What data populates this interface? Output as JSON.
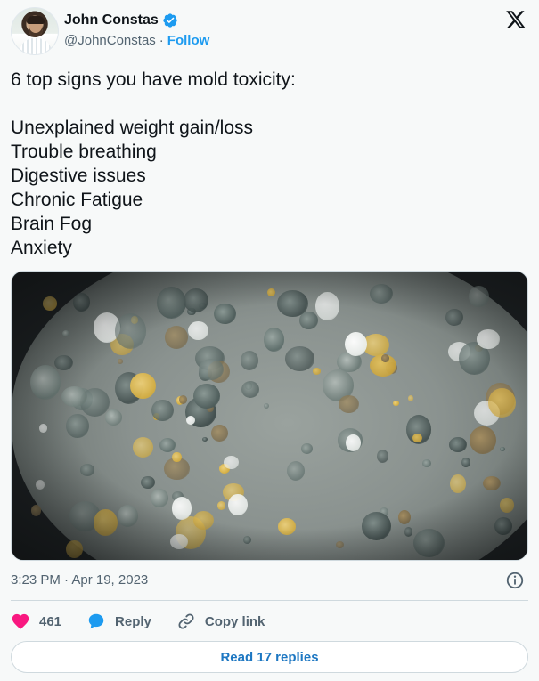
{
  "author": {
    "name": "John Constas",
    "handle": "@JohnConstas",
    "separator": "·",
    "follow_label": "Follow"
  },
  "tweet": {
    "intro": "6 top signs you have mold toxicity:",
    "signs": [
      "Unexplained weight gain/loss",
      "Trouble breathing",
      "Digestive issues",
      "Chronic Fatigue",
      "Brain Fog",
      "Anxiety"
    ],
    "timestamp": "3:23 PM · Apr 19, 2023"
  },
  "actions": {
    "like_count": "461",
    "reply_label": "Reply",
    "copy_link_label": "Copy link"
  },
  "read_replies_label": "Read 17 replies",
  "colors": {
    "accent": "#1d9bf0",
    "like": "#f91880",
    "text": "#0f1419",
    "muted": "#536471",
    "background": "#f7f9f9"
  },
  "icons": [
    "verified-badge-icon",
    "x-logo-icon",
    "info-icon",
    "heart-icon",
    "reply-bubble-icon",
    "link-icon"
  ]
}
